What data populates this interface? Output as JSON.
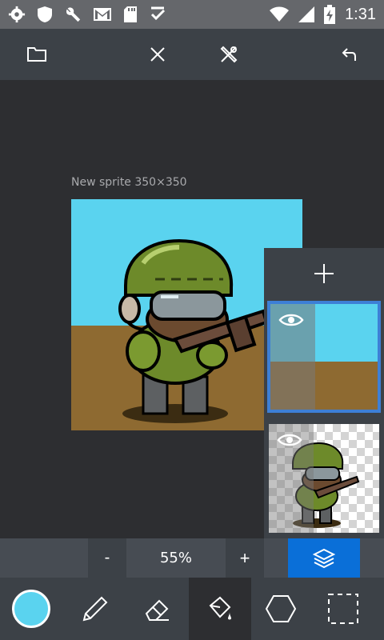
{
  "status_bar": {
    "time": "1:31",
    "icons": [
      "gear-icon",
      "shield-icon",
      "wrench-icon",
      "gmail-icon",
      "sd-card-icon",
      "check-icon",
      "wifi-icon",
      "signal-icon",
      "battery-charging-icon"
    ]
  },
  "toolbar": {
    "icons": [
      "folder-icon",
      "close-icon",
      "tools-icon",
      "undo-icon"
    ]
  },
  "canvas": {
    "label": "New sprite 350×350"
  },
  "layers": {
    "add_icon": "plus-icon",
    "items": [
      {
        "name": "background-layer",
        "visible": true,
        "selected": true
      },
      {
        "name": "character-layer",
        "visible": true,
        "selected": false
      }
    ]
  },
  "zoom": {
    "minus": "-",
    "value": "55%",
    "plus": "+"
  },
  "tools": {
    "items": [
      "color-swatch",
      "pencil-icon",
      "eraser-icon",
      "fill-bucket-icon",
      "hexagon-icon",
      "selection-icon"
    ],
    "active": "fill-bucket-icon"
  },
  "colors": {
    "primary_color": "#5ad3ef",
    "accent": "#0a6fd8",
    "selected_layer_border": "#3d7fd6",
    "sky": "#5ad3ef",
    "ground": "#8e6a31"
  }
}
